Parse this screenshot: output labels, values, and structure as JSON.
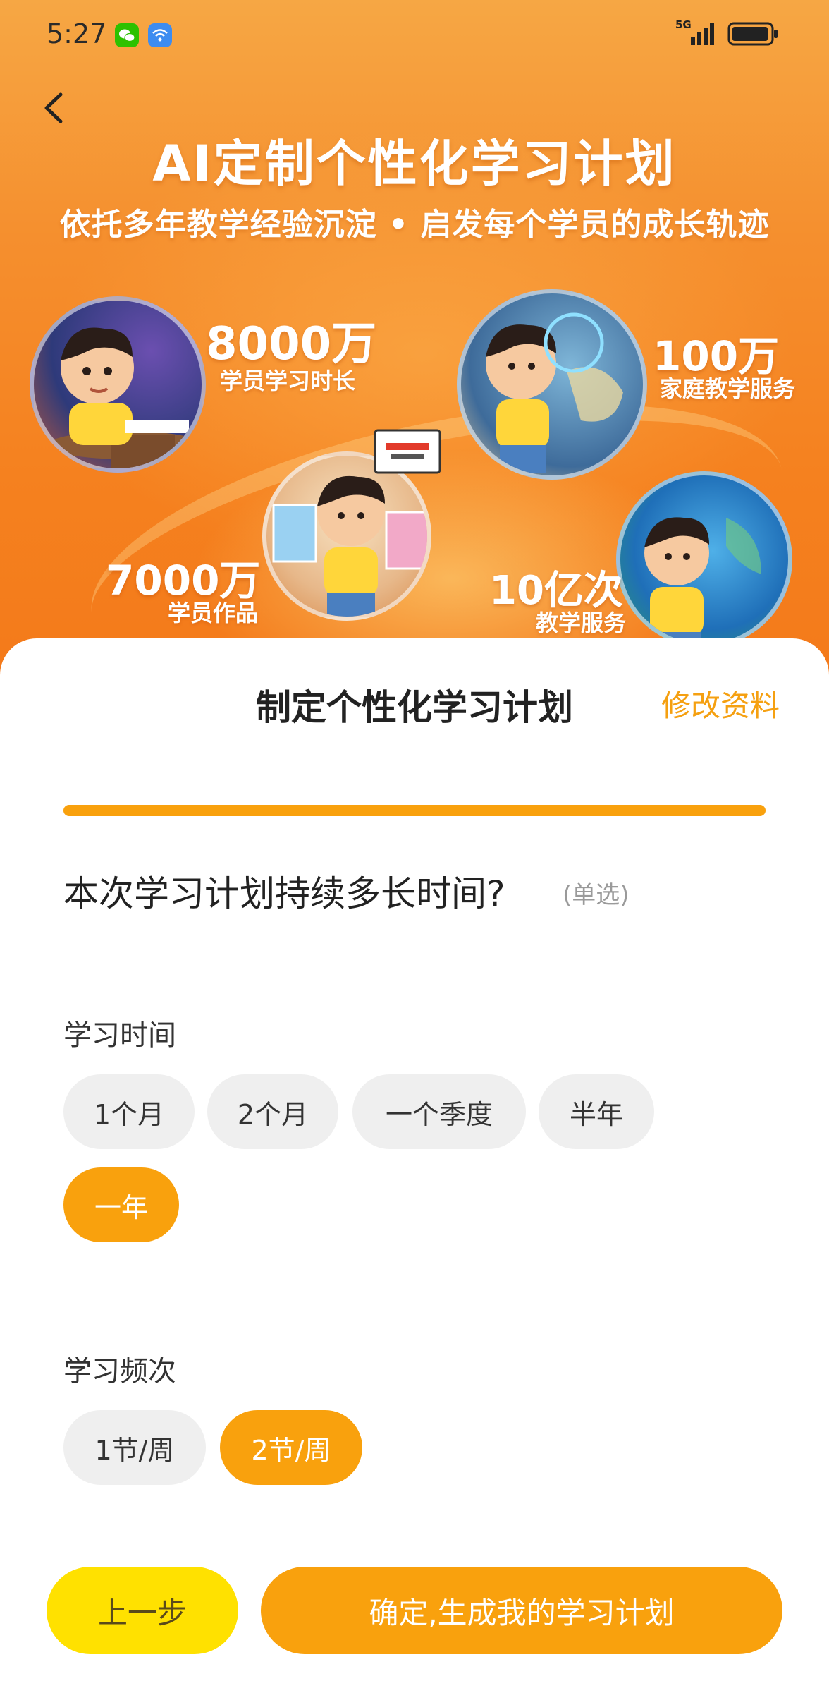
{
  "status_bar": {
    "time": "5:27",
    "network": "5G",
    "icons": [
      "wechat-icon",
      "wifi-app-icon",
      "signal-icon",
      "battery-icon"
    ]
  },
  "hero": {
    "title": "AI定制个性化学习计划",
    "subtitle": "依托多年教学经验沉淀 • 启发每个学员的成长轨迹",
    "stats": [
      {
        "number": "8000万",
        "label": "学员学习时长"
      },
      {
        "number": "100万",
        "label": "家庭教学服务"
      },
      {
        "number": "7000万",
        "label": "学员作品"
      },
      {
        "number": "10亿次",
        "label": "教学服务"
      }
    ]
  },
  "sheet": {
    "title": "制定个性化学习计划",
    "edit_link": "修改资料",
    "progress": 1.0,
    "question": "本次学习计划持续多长时间?",
    "question_hint": "(单选)",
    "duration": {
      "label": "学习时间",
      "options": [
        "1个月",
        "2个月",
        "一个季度",
        "半年",
        "一年"
      ],
      "selected": "一年"
    },
    "frequency": {
      "label": "学习频次",
      "options": [
        "1节/周",
        "2节/周"
      ],
      "selected": "2节/周"
    },
    "buttons": {
      "prev": "上一步",
      "confirm": "确定,生成我的学习计划"
    }
  },
  "colors": {
    "accent": "#f9a10d",
    "prev_button": "#ffe100",
    "chip_bg": "#efefef",
    "hero_orange": "#f5811f"
  }
}
